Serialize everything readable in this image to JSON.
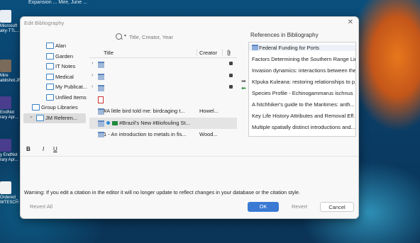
{
  "desktop": {
    "top_text": "Expansion ...   Mire, June ...",
    "icons": [
      {
        "label": "Microsoft alry-TTL...",
        "color": "#e9eef5"
      },
      {
        "label": "Mire abitshot.JF",
        "color": "#7a6a5a"
      },
      {
        "label": "EndNot rary Apr...",
        "color": "#4a3d8e"
      },
      {
        "label": "y EndNot rary Apr...",
        "color": "#4a3d8e"
      },
      {
        "label": "Ordered_ WTESCH",
        "color": "#f2f2f2"
      }
    ]
  },
  "dialog": {
    "title": "Edit Bibliography",
    "close_glyph": "✕",
    "search": {
      "placeholder": "Title, Creator, Year",
      "icon": "search-icon"
    },
    "library": [
      {
        "label": "Alan",
        "icon": "folder-icon",
        "indent": "folder"
      },
      {
        "label": "Garden",
        "icon": "folder-icon",
        "indent": "folder"
      },
      {
        "label": "IT Notes",
        "icon": "folder-icon",
        "indent": "folder"
      },
      {
        "label": "Medical",
        "icon": "folder-icon",
        "indent": "folder"
      },
      {
        "label": "My Publicat...",
        "icon": "folder-icon",
        "indent": "section"
      },
      {
        "label": "Unfiled Items",
        "icon": "unfiled-icon",
        "indent": "section"
      },
      {
        "label": "Group Libraries",
        "icon": "group-icon",
        "indent": "group"
      },
      {
        "label": "JM Referen...",
        "icon": "library-icon",
        "indent": "group",
        "selected": true
      }
    ],
    "columns": {
      "title": "Title",
      "creator": "Creator",
      "attachment_icon": "paperclip-icon"
    },
    "items": [
      {
        "title": "",
        "creator": "",
        "expand": "›",
        "attachment": true
      },
      {
        "title": "",
        "creator": "",
        "expand": "›",
        "attachment": true
      },
      {
        "title": "",
        "creator": "",
        "expand": "›",
        "attachment": true
      },
      {
        "title": "",
        "creator": "",
        "expand": "",
        "attachment": false,
        "pdf": true
      },
      {
        "title": "#A little bird told me: birdcaging t...",
        "creator": "Howel...",
        "expand": "",
        "attachment": false
      },
      {
        "title": "#Brazil's New #Biofouling St...",
        "creator": "",
        "expand": "",
        "attachment": false,
        "selected": true
      },
      {
        "title": "1 - An introduction to metals in fis...",
        "creator": "Wood...",
        "expand": "",
        "attachment": false
      }
    ],
    "move_right": "➡",
    "move_left": "⬅",
    "refs_title": "References in Bibliography",
    "references": [
      "Federal Funding for Ports",
      "Factors Determining the Southern Range Limit...",
      "Invasion dynamics: interactions between the...",
      "Kīpuka Kuleana: restoring relationships to p...",
      "Species Profile - Echinogammarus ischnus",
      "A hitchhiker's guide to the Maritimes: anth...",
      "Key Life History Attributes and Removal Eff...",
      "Multiple spatially distinct introductions and..."
    ],
    "format": {
      "bold": "B",
      "italic": "I",
      "underline": "U"
    },
    "warning": "Warning: If you edit a citation in the editor it will no longer update to reflect changes in your database or the citation style.",
    "buttons": {
      "revert_all": "Revert All",
      "ok": "OK",
      "revert": "Revert",
      "cancel": "Cancel"
    },
    "accent": "#3a79d4"
  }
}
